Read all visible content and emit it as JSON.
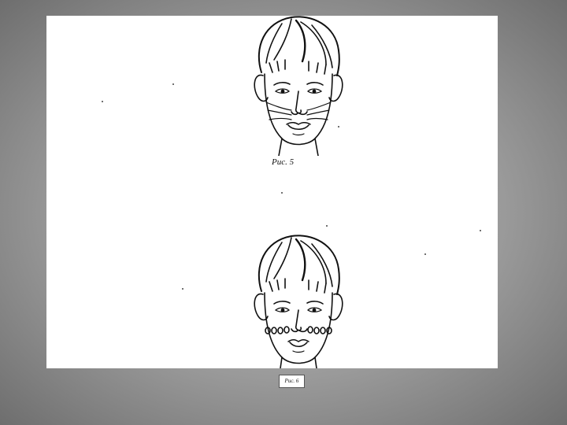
{
  "figures": {
    "top": {
      "caption": "Рис. 5"
    },
    "bottom": {
      "caption": "Рис. 6"
    }
  },
  "icons": {
    "top_face": "boy-face-massage-lines-illustration",
    "bottom_face": "boy-face-massage-dots-illustration"
  },
  "colors": {
    "background": "#9a9a9a",
    "panel": "#ffffff",
    "ink": "#111111"
  }
}
